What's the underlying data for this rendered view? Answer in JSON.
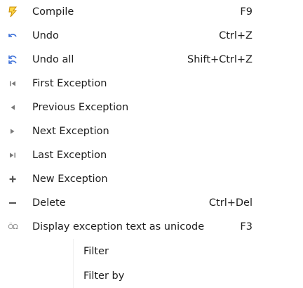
{
  "menu": {
    "items": [
      {
        "label": "Compile",
        "shortcut": "F9",
        "icon": "lightning-icon"
      },
      {
        "label": "Undo",
        "shortcut": "Ctrl+Z",
        "icon": "undo-icon"
      },
      {
        "label": "Undo all",
        "shortcut": "Shift+Ctrl+Z",
        "icon": "undo-all-icon"
      },
      {
        "label": "First Exception",
        "shortcut": "",
        "icon": "first-icon"
      },
      {
        "label": "Previous Exception",
        "shortcut": "",
        "icon": "previous-icon"
      },
      {
        "label": "Next Exception",
        "shortcut": "",
        "icon": "next-icon"
      },
      {
        "label": "Last Exception",
        "shortcut": "",
        "icon": "last-icon"
      },
      {
        "label": "New Exception",
        "shortcut": "",
        "icon": "plus-icon"
      },
      {
        "label": "Delete",
        "shortcut": "Ctrl+Del",
        "icon": "minus-icon"
      },
      {
        "label": "Display exception text as unicode",
        "shortcut": "F3",
        "icon": "omega-icon",
        "icon_text": "ÖΩ"
      }
    ]
  },
  "submenu": {
    "items": [
      {
        "label": "Filter"
      },
      {
        "label": "Filter by"
      }
    ]
  },
  "colors": {
    "lightning": "#e0a800",
    "undo": "#3b6fd8",
    "nav": "#7a7a7a",
    "plus_minus": "#555555",
    "text": "#1e1e1e"
  }
}
